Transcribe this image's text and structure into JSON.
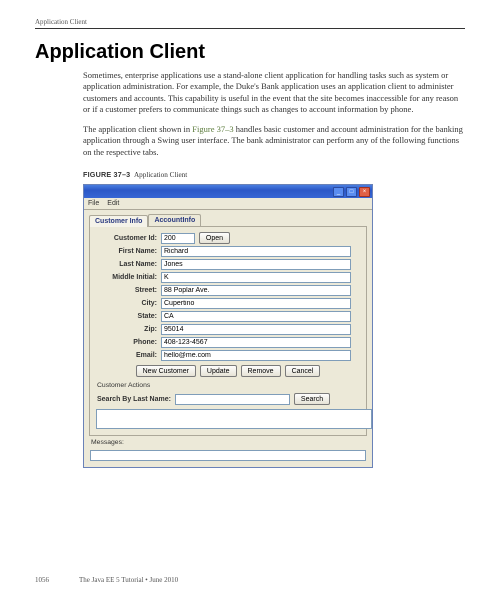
{
  "runningHeader": "Application Client",
  "title": "Application Client",
  "para1": "Sometimes, enterprise applications use a stand-alone client application for handling tasks such as system or application administration. For example, the Duke's Bank application uses an application client to administer customers and accounts. This capability is useful in the event that the site becomes inaccessible for any reason or if a customer prefers to communicate things such as changes to account information by phone.",
  "para2a": "The application client shown in ",
  "para2link": "Figure 37–3",
  "para2b": " handles basic customer and account administration for the banking application through a Swing user interface. The bank administrator can perform any of the following functions on the respective tabs.",
  "figureLabel": "FIGURE 37–3",
  "figureCaption": "Application Client",
  "window": {
    "menubar": {
      "file": "File",
      "edit": "Edit"
    },
    "tabs": {
      "customer": "Customer Info",
      "account": "AccountInfo"
    },
    "fields": {
      "customerId": {
        "label": "Customer Id:",
        "value": "200"
      },
      "firstName": {
        "label": "First Name:",
        "value": "Richard"
      },
      "lastName": {
        "label": "Last Name:",
        "value": "Jones"
      },
      "middleInitial": {
        "label": "Middle Initial:",
        "value": "K"
      },
      "street": {
        "label": "Street:",
        "value": "88 Poplar Ave."
      },
      "city": {
        "label": "City:",
        "value": "Cupertino"
      },
      "state": {
        "label": "State:",
        "value": "CA"
      },
      "zip": {
        "label": "Zip:",
        "value": "95014"
      },
      "phone": {
        "label": "Phone:",
        "value": "408-123-4567"
      },
      "email": {
        "label": "Email:",
        "value": "hello@me.com"
      }
    },
    "buttons": {
      "open": "Open",
      "newCustomer": "New Customer",
      "update": "Update",
      "remove": "Remove",
      "cancel": "Cancel",
      "search": "Search"
    },
    "sections": {
      "customerActions": "Customer Actions",
      "searchByLastName": "Search By Last Name:",
      "messages": "Messages:"
    }
  },
  "footer": {
    "pageNum": "1056",
    "bookTitle": "The Java EE 5 Tutorial • June 2010"
  }
}
